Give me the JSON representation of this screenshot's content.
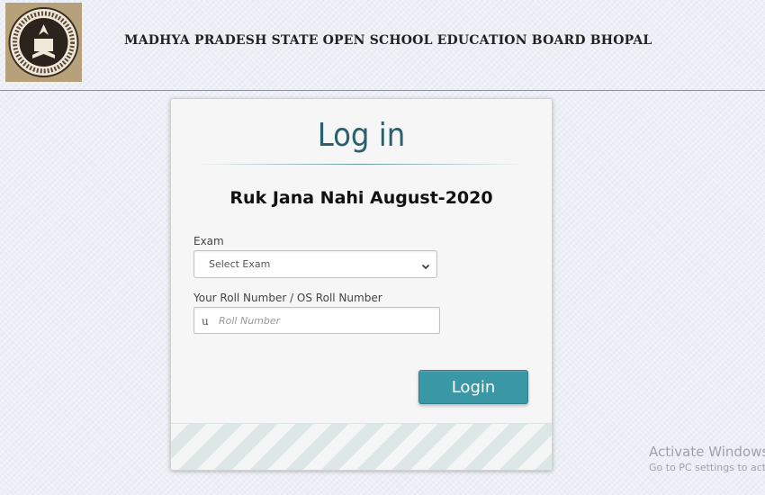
{
  "header": {
    "board_title": "MADHYA PRADESH STATE OPEN SCHOOL EDUCATION BOARD BHOPAL"
  },
  "login_card": {
    "heading": "Log in",
    "subtitle": "Ruk Jana Nahi August-2020",
    "exam_label": "Exam",
    "exam_selected": "Select Exam",
    "roll_label": "Your Roll Number / OS Roll Number",
    "roll_prefix": "u",
    "roll_placeholder": "Roll Number",
    "roll_value": "",
    "login_label": "Login"
  },
  "watermark": {
    "line1": "Activate Windows",
    "line2": "Go to PC settings to act"
  },
  "colors": {
    "accent": "#3a97a6",
    "heading": "#2a5f6c"
  }
}
